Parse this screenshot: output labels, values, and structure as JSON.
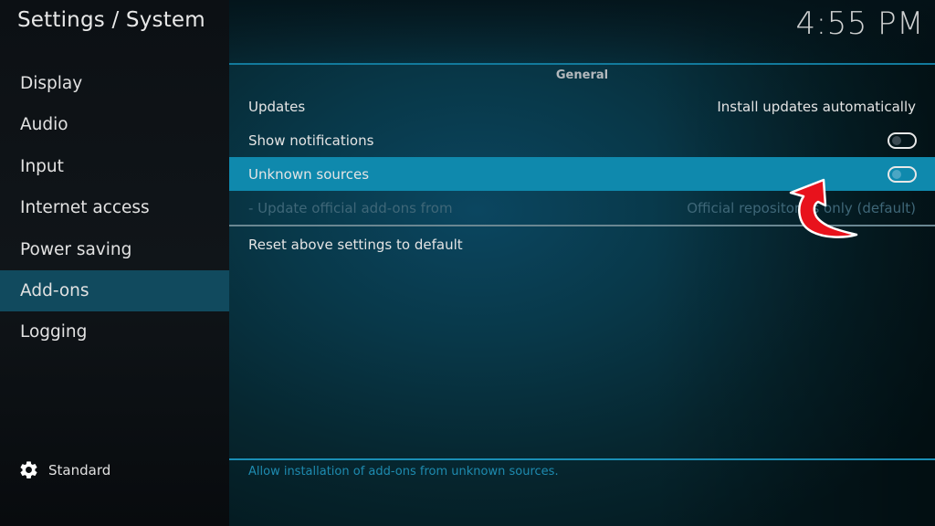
{
  "header": {
    "title": "Settings / System",
    "clock": "4:55 PM"
  },
  "sidebar": {
    "items": [
      {
        "label": "Display",
        "active": false
      },
      {
        "label": "Audio",
        "active": false
      },
      {
        "label": "Input",
        "active": false
      },
      {
        "label": "Internet access",
        "active": false
      },
      {
        "label": "Power saving",
        "active": false
      },
      {
        "label": "Add-ons",
        "active": true
      },
      {
        "label": "Logging",
        "active": false
      }
    ],
    "settings_level": {
      "icon": "gear-icon",
      "label": "Standard"
    }
  },
  "main": {
    "group_header": "General",
    "settings": [
      {
        "label": "Updates",
        "value": "Install updates automatically",
        "type": "select",
        "state": "normal"
      },
      {
        "label": "Show notifications",
        "type": "toggle",
        "enabled": false,
        "state": "normal"
      },
      {
        "label": "Unknown sources",
        "type": "toggle",
        "enabled": false,
        "state": "focused"
      },
      {
        "label": "- Update official add-ons from",
        "value": "Official repositories only (default)",
        "type": "select",
        "state": "disabled"
      }
    ],
    "reset_label": "Reset above settings to default",
    "help_text": "Allow installation of add-ons from unknown sources."
  },
  "annotation": {
    "icon": "red-curved-arrow-icon",
    "color": "#e8121c"
  },
  "colors": {
    "accent": "#0f89ad",
    "sidebar_active": "#114a5e",
    "help_text": "#1e8bb0"
  }
}
